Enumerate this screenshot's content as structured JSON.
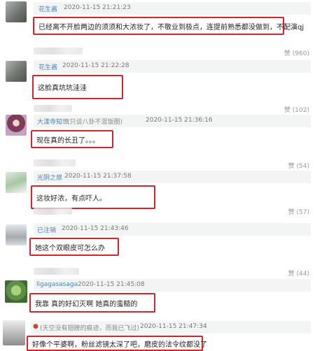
{
  "comments": [
    {
      "name": "花生酱",
      "time": "2020-11-15 21:21:23",
      "text": "已经离不开脸两边的须须和大浓妆了，不敬业到极点，连提前熟悉都没做到，不配演qj",
      "like_label": "赞",
      "like_count": "(960)",
      "avatar_color": "#7a7f7a"
    },
    {
      "name": "花生酱",
      "time": "2020-11-15 21:22:28",
      "text": "这脸真坑坑洼洼",
      "like_label": "赞",
      "like_count": "(102)",
      "avatar_color": "#7a7f7a"
    },
    {
      "name": "大漾寺知世",
      "badge": "(只谈八卦不混饭圈)",
      "time": "2020-11-15 21:36:16",
      "text": "现在真的长丑了。。。",
      "like_label": "赞",
      "like_count": "(54)",
      "avatar_color": "#8a5a7a"
    },
    {
      "name": "光阴之旅",
      "time": "2020-11-15 21:37:58",
      "text": "这妆好浓，有点吓人。",
      "like_label": "赞",
      "like_count": "(57)",
      "avatar_color": "#9fc0a0"
    },
    {
      "name": "已注销",
      "time": "2020-11-15 21:43:46",
      "text": "她这个双眼皮可怎么办",
      "like_label": "赞",
      "like_count": "(44)",
      "avatar_color": "#c8ccd0"
    },
    {
      "name": "ligagasasaga",
      "time": "2020-11-15 21:45:08",
      "text": "我靠 真的好幻灭啊 她真的蛮糙的",
      "like_label": "赞",
      "like_count": "",
      "avatar_color": "#5f8f46"
    },
    {
      "name": "(天空没有翅膀的痕迹，而我已飞过)",
      "time": "2020-11-15 21:47:34",
      "text": "好像个平婆啊，粉丝滤镜太深了吧，磨皮的法令纹都没了",
      "like_label": "",
      "like_count": "",
      "avatar_color": "#b8b8b8"
    }
  ]
}
